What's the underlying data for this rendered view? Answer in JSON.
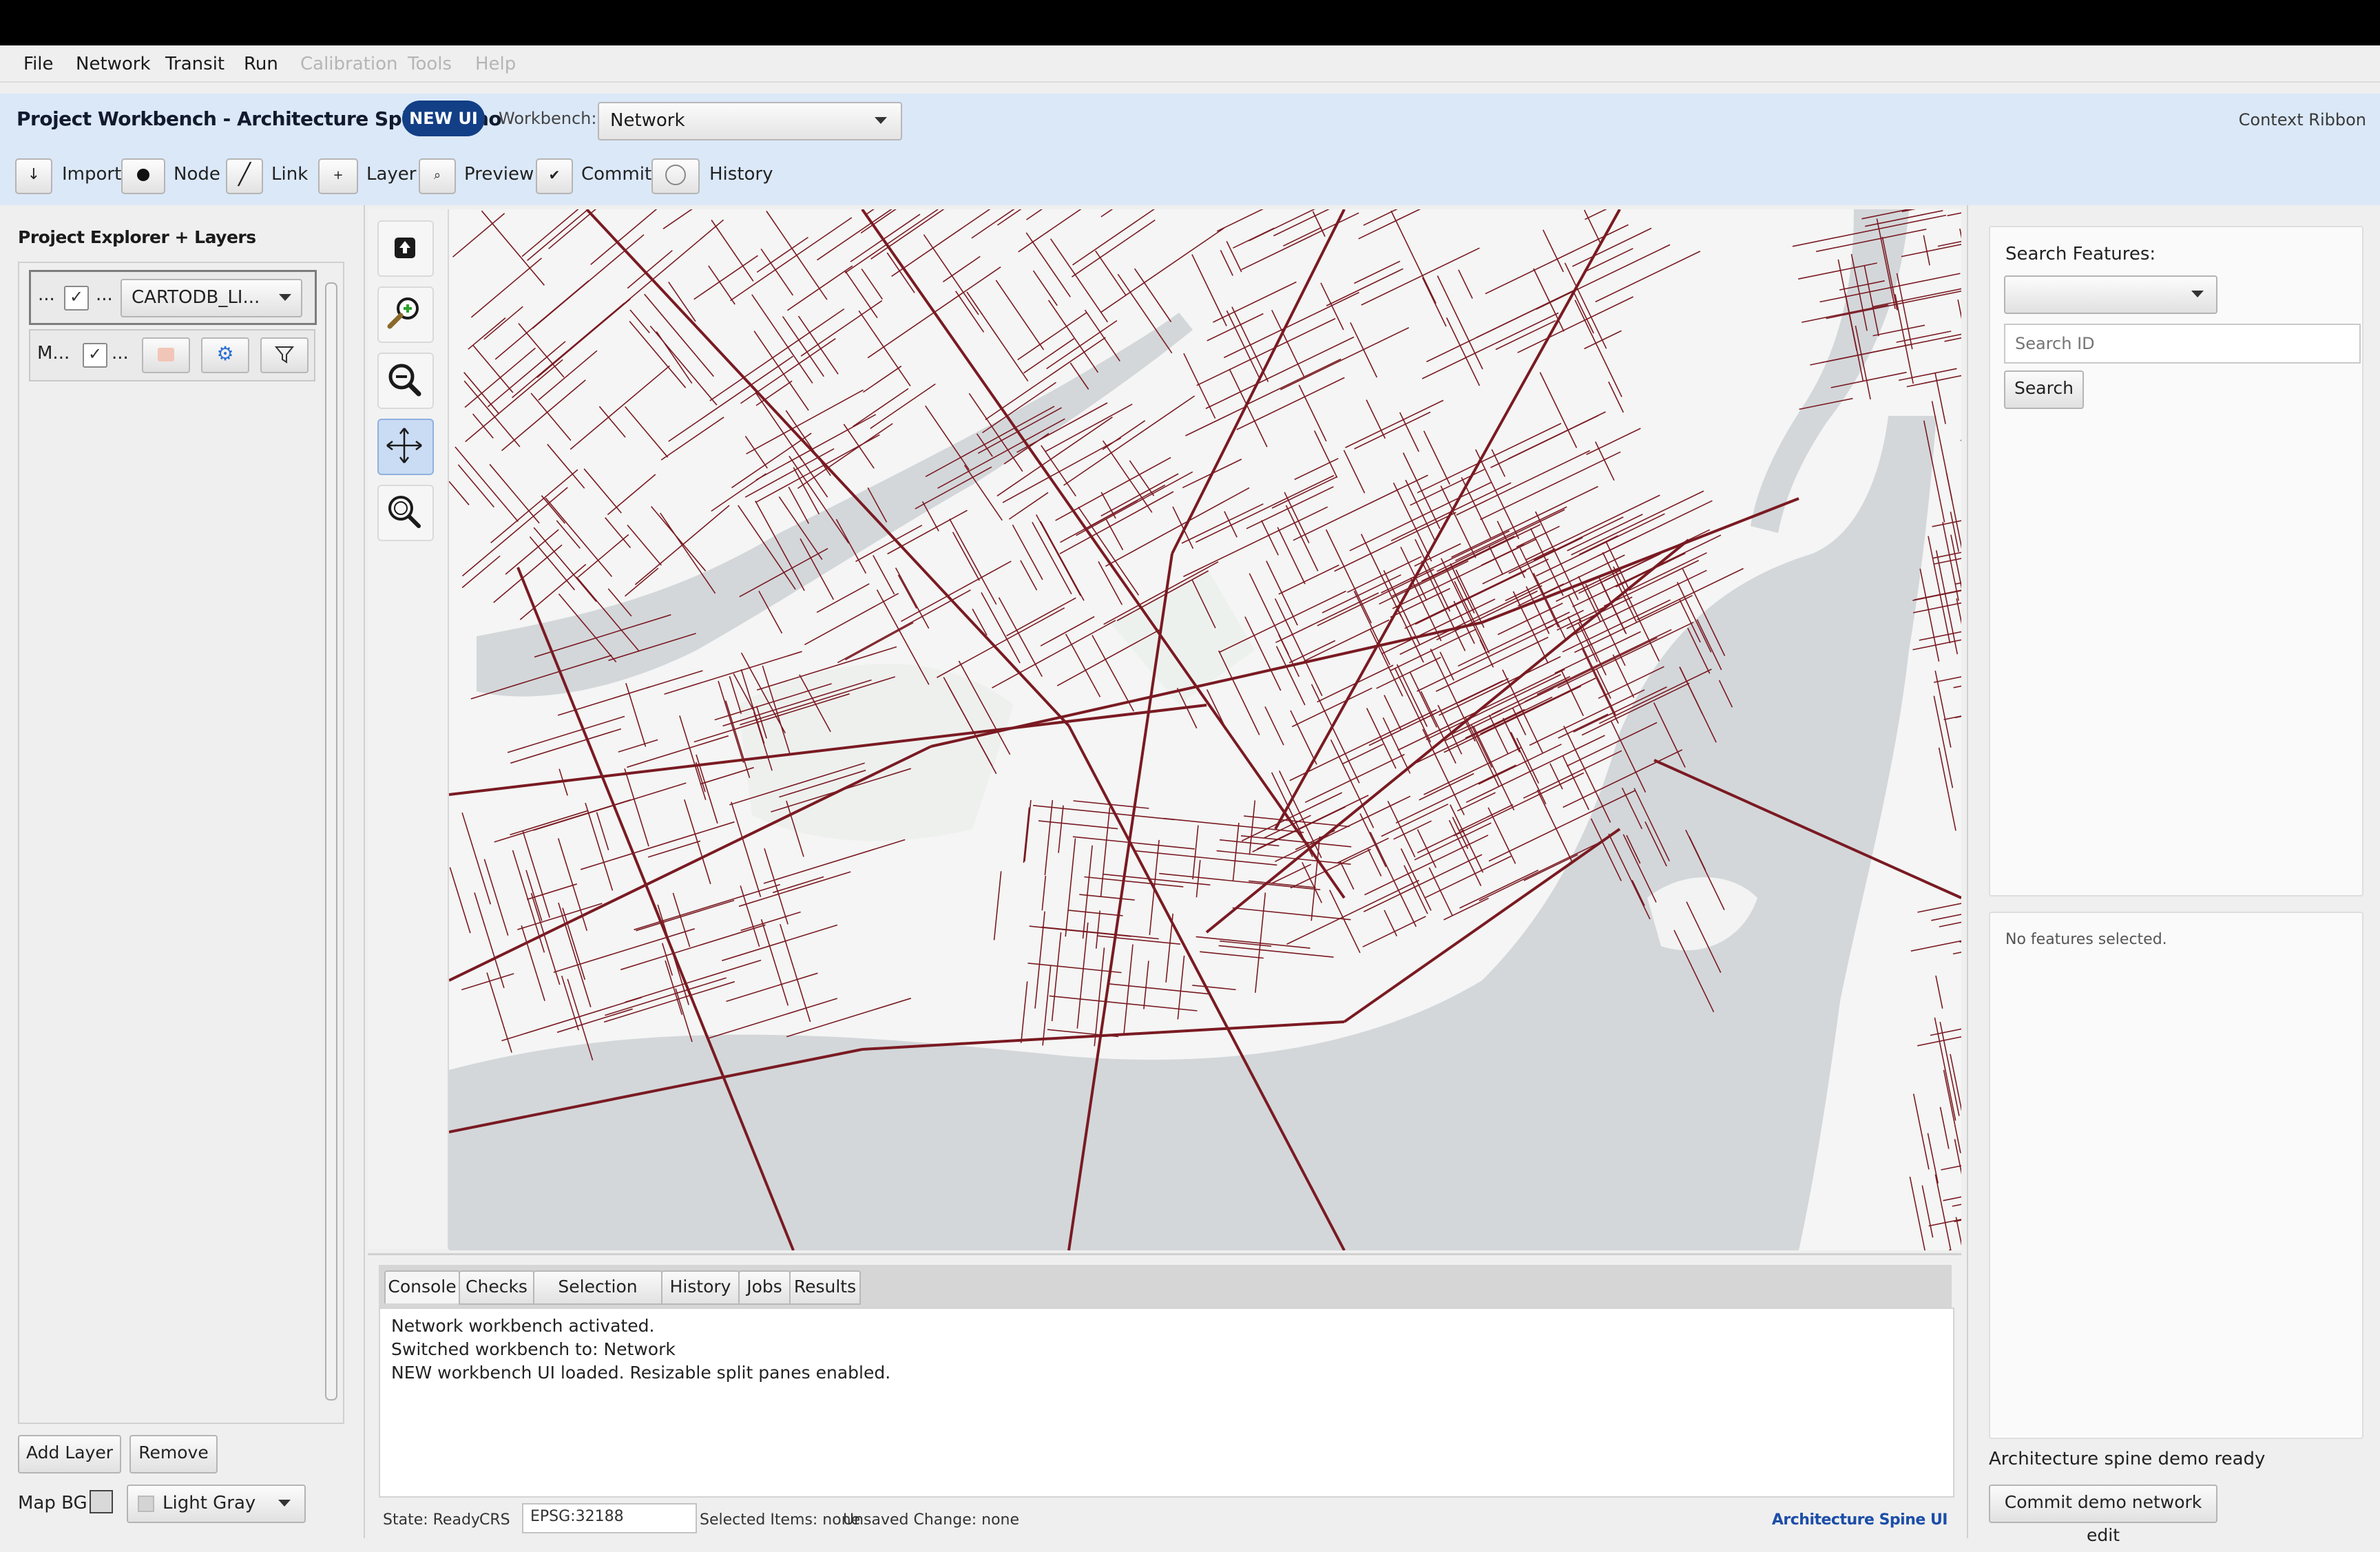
{
  "menu": {
    "items": [
      {
        "label": "File",
        "enabled": true
      },
      {
        "label": "Network",
        "enabled": true
      },
      {
        "label": "Transit",
        "enabled": true
      },
      {
        "label": "Run",
        "enabled": true
      },
      {
        "label": "Calibration",
        "enabled": false
      },
      {
        "label": "Tools",
        "enabled": false
      },
      {
        "label": "Help",
        "enabled": false
      }
    ]
  },
  "header": {
    "title": "Project Workbench - Architecture Spine Demo",
    "badge": "NEW UI",
    "workbench_label": "Workbench:",
    "workbench_value": "Network",
    "context_ribbon": "Context Ribbon"
  },
  "toolbar": {
    "import": {
      "icon": "download-arrow-icon",
      "label": "Import"
    },
    "node": {
      "icon": "dot-icon",
      "label": "Node"
    },
    "link": {
      "icon": "slash-line-icon",
      "label": "Link"
    },
    "layer": {
      "icon": "plus-icon",
      "label": "Layer"
    },
    "preview": {
      "icon": "magnifier-icon",
      "label": "Preview"
    },
    "commit": {
      "icon": "checkmark-icon",
      "label": "Commit"
    },
    "history": {
      "icon": "clock-icon",
      "label": "History"
    }
  },
  "explorer": {
    "title": "Project Explorer + Layers",
    "rows": [
      {
        "name": "...",
        "checked": true,
        "sub": "...",
        "basemap": "CARTODB_LI..."
      },
      {
        "name": "M...",
        "checked": true,
        "sub": "..."
      }
    ],
    "add_layer": "Add Layer",
    "remove": "Remove",
    "map_bg_label": "Map BG",
    "map_bg_value": "Light Gray"
  },
  "console": {
    "tabs": [
      "Console",
      "Checks",
      "Selection Table",
      "History",
      "Jobs",
      "Results"
    ],
    "active_tab": "Console",
    "lines": [
      "Network workbench activated.",
      "Switched workbench to: Network",
      "NEW workbench UI loaded. Resizable split panes enabled."
    ]
  },
  "status": {
    "state": "State: Ready",
    "crs_label": "CRS",
    "crs_value": "EPSG:32188",
    "selected": "Selected Items: none",
    "unsaved": "Unsaved Change: none",
    "brand": "Architecture Spine UI"
  },
  "right": {
    "search_label": "Search Features:",
    "search_type_value": "",
    "search_placeholder": "Search ID",
    "search_button": "Search",
    "selection_info": "No features selected.",
    "ready_text": "Architecture spine demo ready",
    "commit_button": "Commit demo network edit"
  },
  "colors": {
    "accent": "#123f86",
    "network": "#7a1a22",
    "water": "#d3d7da",
    "ribbon": "#dbe8f8",
    "link": "#1c4ea8"
  }
}
